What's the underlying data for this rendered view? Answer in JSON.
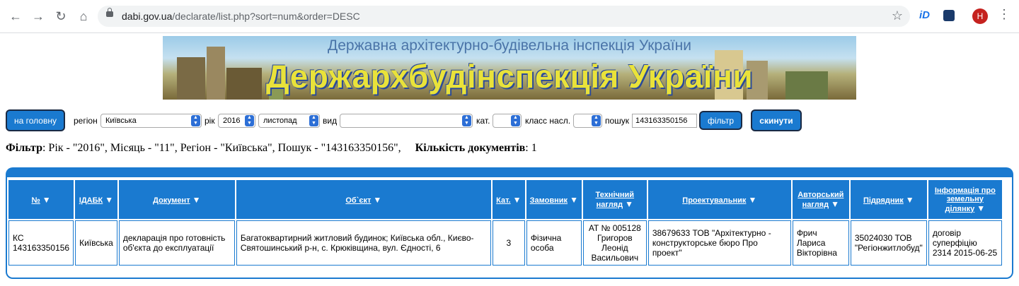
{
  "browser": {
    "url_host": "dabi.gov.ua",
    "url_path": "/declarate/list.php?sort=num&order=DESC",
    "ext_label": "iD",
    "avatar_letter": "Н"
  },
  "banner": {
    "subtitle": "Державна архітектурно-будівельна інспекція України",
    "title": "Держархбудінспекція України"
  },
  "filters": {
    "home_button": "на головну",
    "region_label": "регіон",
    "region_value": "Київська",
    "year_label": "рік",
    "year_value": "2016",
    "month_value": "листопад",
    "type_label": "вид",
    "type_value": "",
    "cat_label": "кат.",
    "class_label": "класс насл.",
    "search_label": "пошук",
    "search_value": "143163350156",
    "filter_button": "фільтр",
    "reset_button": "скинути"
  },
  "summary": {
    "filter_label": "Фільтр",
    "filter_text": ": Рік - \"2016\", Місяць - \"11\", Регіон - \"Київська\", Пошук - \"143163350156\",",
    "count_label": "Кількість документів",
    "count_value": ": 1"
  },
  "table": {
    "headers": [
      "№",
      "ІДАБК",
      "Документ",
      "Об`єкт",
      "Кат.",
      "Замовник",
      "Технічний нагляд",
      "Проектувальник",
      "Авторський нагляд",
      "Підрядник",
      "Інформація про земельну ділянку"
    ],
    "rows": [
      [
        "КС 143163350156",
        "Київська",
        "декларація про готовність об'єкта до експлуатації",
        "Багатоквартирний житловий будинок; Київська обл., Києво-Святошинський р-н, с. Крюківщина, вул. Єдності, 6",
        "3",
        "Фізична особа",
        "АТ № 005128 Григоров Леонід Васильович",
        "38679633 ТОВ \"Архітектурно - конструкторське бюро Про проект\"",
        "Фрич Лариса Вікторівна",
        "35024030 ТОВ \"Регіонжитлобуд\"",
        "договір суперфіцію 2314 2015-06-25"
      ]
    ]
  }
}
